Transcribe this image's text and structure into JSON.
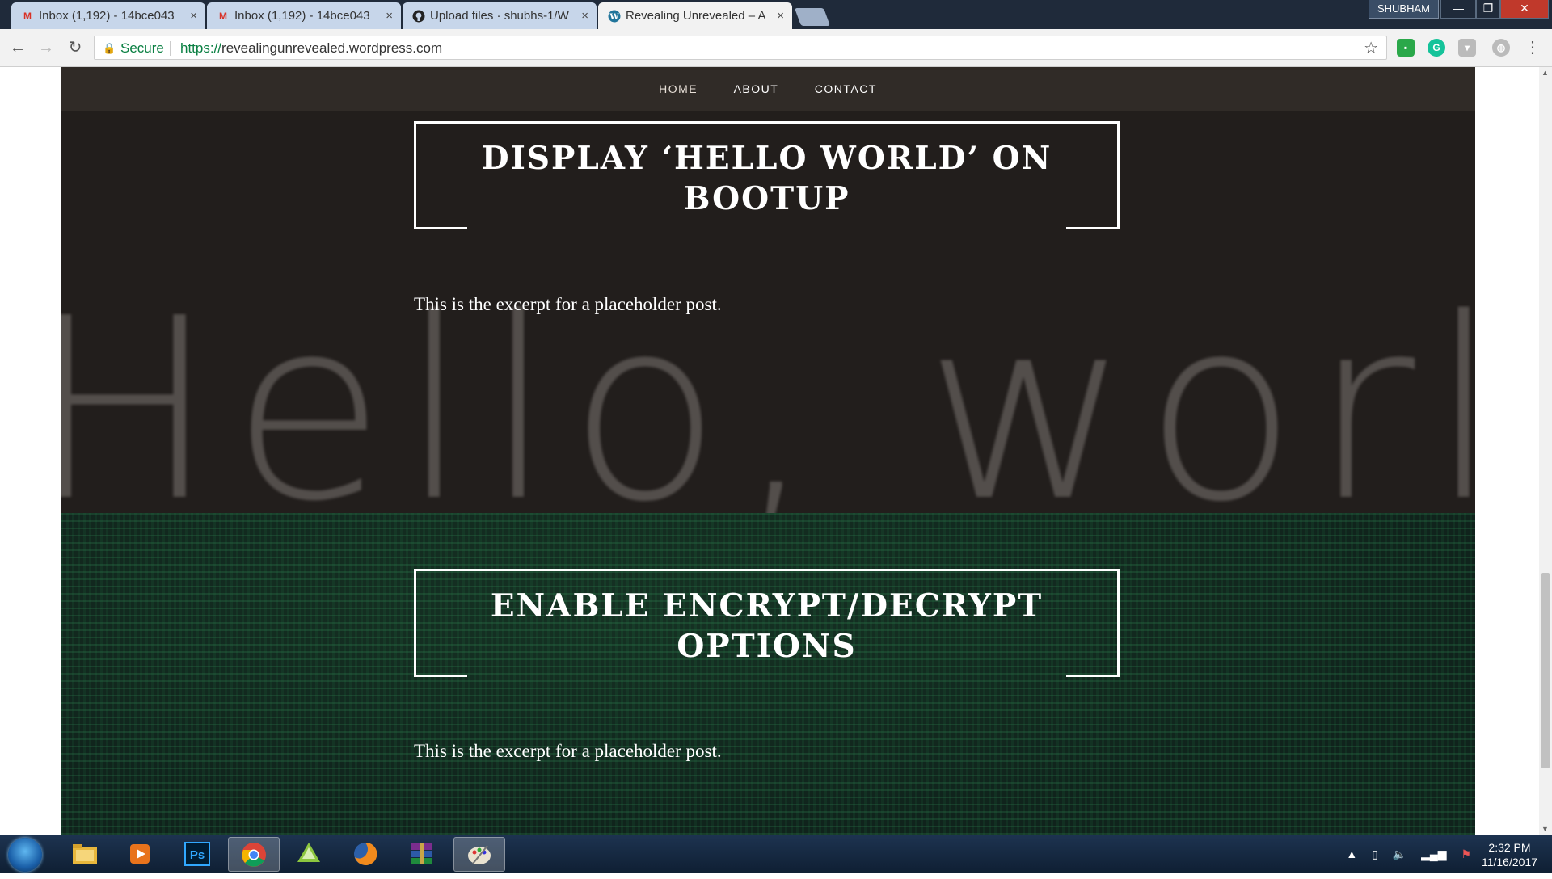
{
  "browser": {
    "tabs": [
      {
        "title": "Inbox (1,192) - 14bce043",
        "icon": "gmail-icon"
      },
      {
        "title": "Inbox (1,192) - 14bce043",
        "icon": "gmail-icon"
      },
      {
        "title": "Upload files · shubhs-1/W",
        "icon": "github-icon"
      },
      {
        "title": "Revealing Unrevealed – A",
        "icon": "wordpress-icon",
        "active": true
      }
    ],
    "close_glyph": "×",
    "profile_name": "SHUBHAM",
    "secure_label": "Secure",
    "url_scheme": "https://",
    "url_rest": "revealingunrevealed.wordpress.com"
  },
  "site": {
    "nav": [
      "HOME",
      "ABOUT",
      "CONTACT"
    ],
    "posts": [
      {
        "title": "Display ‘Hello World’ on Bootup",
        "excerpt": "This is the excerpt for a placeholder post.",
        "image_text": "Hello, world"
      },
      {
        "title": "Enable Encrypt/Decrypt Options",
        "excerpt": "This is the excerpt for a placeholder post."
      }
    ]
  },
  "taskbar": {
    "clock_time": "2:32 PM",
    "clock_date": "11/16/2017"
  },
  "colors": {
    "accent_green": "#0b8043",
    "site_bg": "#231f1c",
    "taskbar": "#1d3350"
  }
}
